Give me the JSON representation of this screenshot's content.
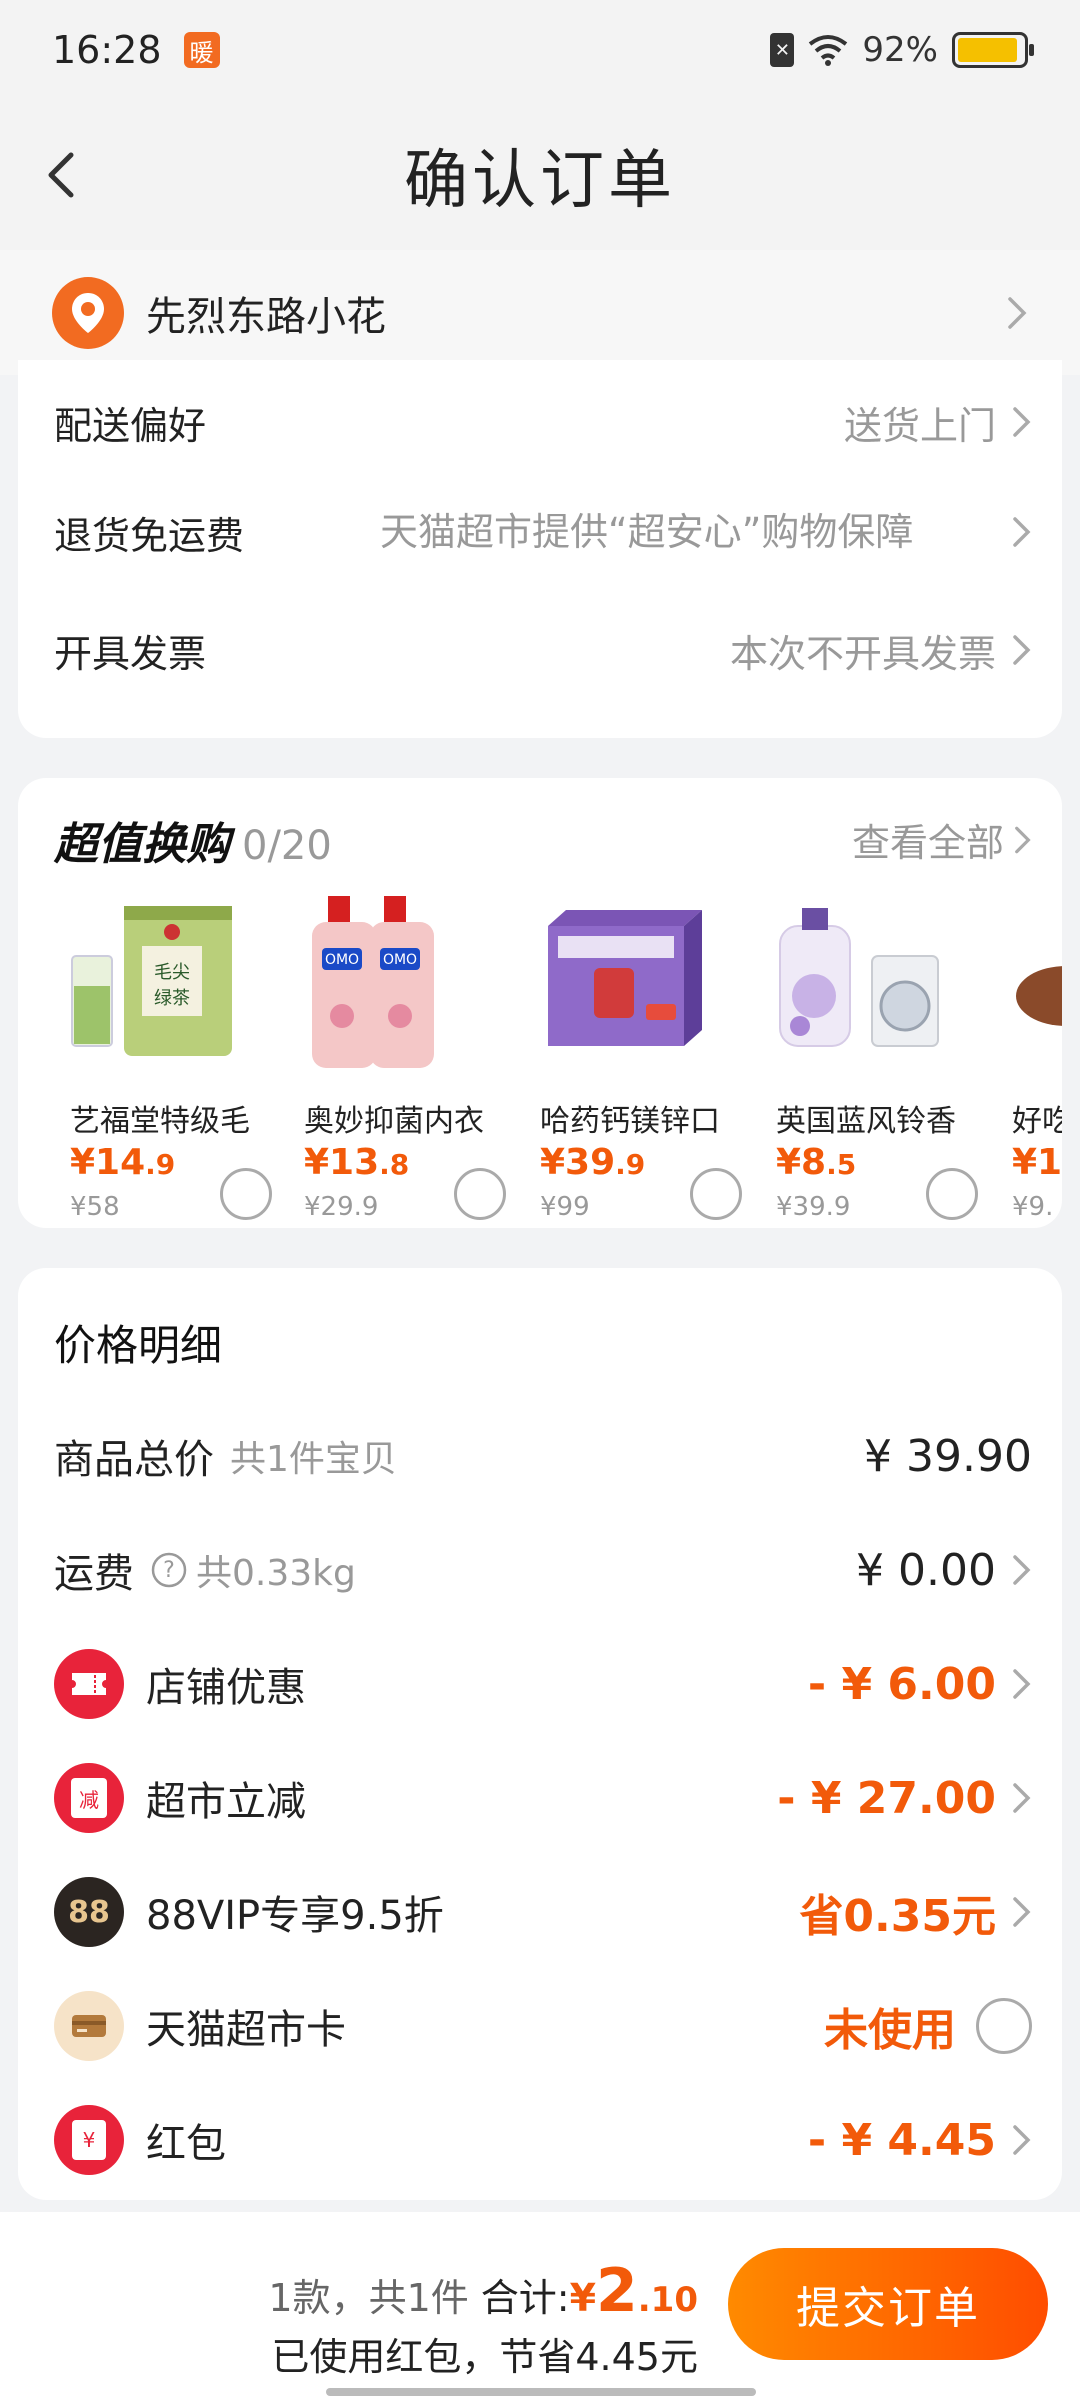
{
  "status": {
    "time": "16:28",
    "app_badge": "暖",
    "battery": "92%",
    "battery_level": 0.92
  },
  "nav": {
    "title": "确认订单"
  },
  "address": {
    "name": "先烈东路小花"
  },
  "options": [
    {
      "label": "配送偏好",
      "value": "送货上门"
    },
    {
      "label": "退货免运费",
      "value": "天猫超市提供“超安心”购物保障"
    },
    {
      "label": "开具发票",
      "value": "本次不开具发票"
    }
  ],
  "swap": {
    "title": "超值换购",
    "count": "0/20",
    "view_all": "查看全部",
    "products": [
      {
        "name": "艺福堂特级毛",
        "price_int": "¥14",
        "price_dec": ".9",
        "orig": "¥58"
      },
      {
        "name": "奥妙抑菌内衣",
        "price_int": "¥13",
        "price_dec": ".8",
        "orig": "¥29.9"
      },
      {
        "name": "哈药钙镁锌口",
        "price_int": "¥39",
        "price_dec": ".9",
        "orig": "¥99"
      },
      {
        "name": "英国蓝风铃香",
        "price_int": "¥8",
        "price_dec": ".5",
        "orig": "¥39.9"
      },
      {
        "name": "好吃",
        "price_int": "¥1",
        "price_dec": "",
        "orig": "¥9."
      }
    ]
  },
  "price": {
    "title": "价格明细",
    "goods_total_label": "商品总价",
    "goods_total_sub": "共1件宝贝",
    "goods_total_value": "¥ 39.90",
    "shipping_label": "运费",
    "shipping_sub": "共0.33kg",
    "shipping_value": "¥ 0.00",
    "store_discount_label": "店铺优惠",
    "store_discount_value": "- ¥ 6.00",
    "market_discount_label": "超市立减",
    "market_discount_value": "- ¥ 27.00",
    "market_discount_icon": "减",
    "vip_label": "88VIP专享9.5折",
    "vip_value": "省0.35元",
    "vip_icon": "88",
    "card_label": "天猫超市卡",
    "card_value": "未使用",
    "redpacket_label": "红包",
    "redpacket_value": "- ¥ 4.45",
    "redpacket_icon": "¥"
  },
  "bottom": {
    "count": "1款，共1件",
    "total_label": "合计:",
    "yen": "¥",
    "amount_int": "2",
    "amount_dec": ".10",
    "saved": "已使用红包，节省4.45元",
    "submit": "提交订单"
  },
  "colors": {
    "accent": "#f25a0a",
    "pin": "#f26b21",
    "battery": "#f5c000"
  }
}
